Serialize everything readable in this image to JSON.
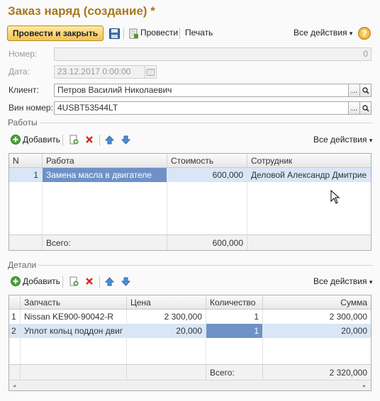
{
  "window": {
    "title": "Заказ наряд (создание) *"
  },
  "toolbar": {
    "post_close_label": "Провести и закрыть",
    "post_label": "Провести",
    "print_label": "Печать",
    "all_actions_label": "Все действия",
    "help_label": "?"
  },
  "form": {
    "number_label": "Номер:",
    "number_value": "0",
    "date_label": "Дата:",
    "date_value": "23.12.2017  0:00:00",
    "client_label": "Клиент:",
    "client_value": "Петров Василий Николаевич",
    "vin_label": "Вин номер:",
    "vin_value": "4USBT53544LT",
    "ellipsis": "..."
  },
  "works": {
    "section_label": "Работы",
    "add_label": "Добавить",
    "all_actions_label": "Все действия",
    "columns": [
      "N",
      "Работа",
      "Стоимость",
      "Сотрудник"
    ],
    "rows": [
      {
        "n": "1",
        "work": "Замена масла в двигателе",
        "cost": "600,000",
        "employee": "Деловой Александр Дмитрие"
      }
    ],
    "total_label": "Всего:",
    "total_value": "600,000"
  },
  "parts": {
    "section_label": "Детали",
    "add_label": "Добавить",
    "all_actions_label": "Все действия",
    "columns": [
      "Запчасть",
      "Цена",
      "Количество",
      "Сумма"
    ],
    "rows": [
      {
        "n": "1",
        "part": "Nissan KE900-90042-R",
        "price": "2 300,000",
        "qty": "1",
        "sum": "2 300,000"
      },
      {
        "n": "2",
        "part": "Уплот кольц поддон двиг",
        "price": "20,000",
        "qty": "1",
        "sum": "20,000"
      }
    ],
    "total_label": "Всего:",
    "total_value": "2 320,000"
  },
  "colors": {
    "title": "#a8771f",
    "selection": "#d9e6f7",
    "selected_cell": "#6e92c8"
  }
}
